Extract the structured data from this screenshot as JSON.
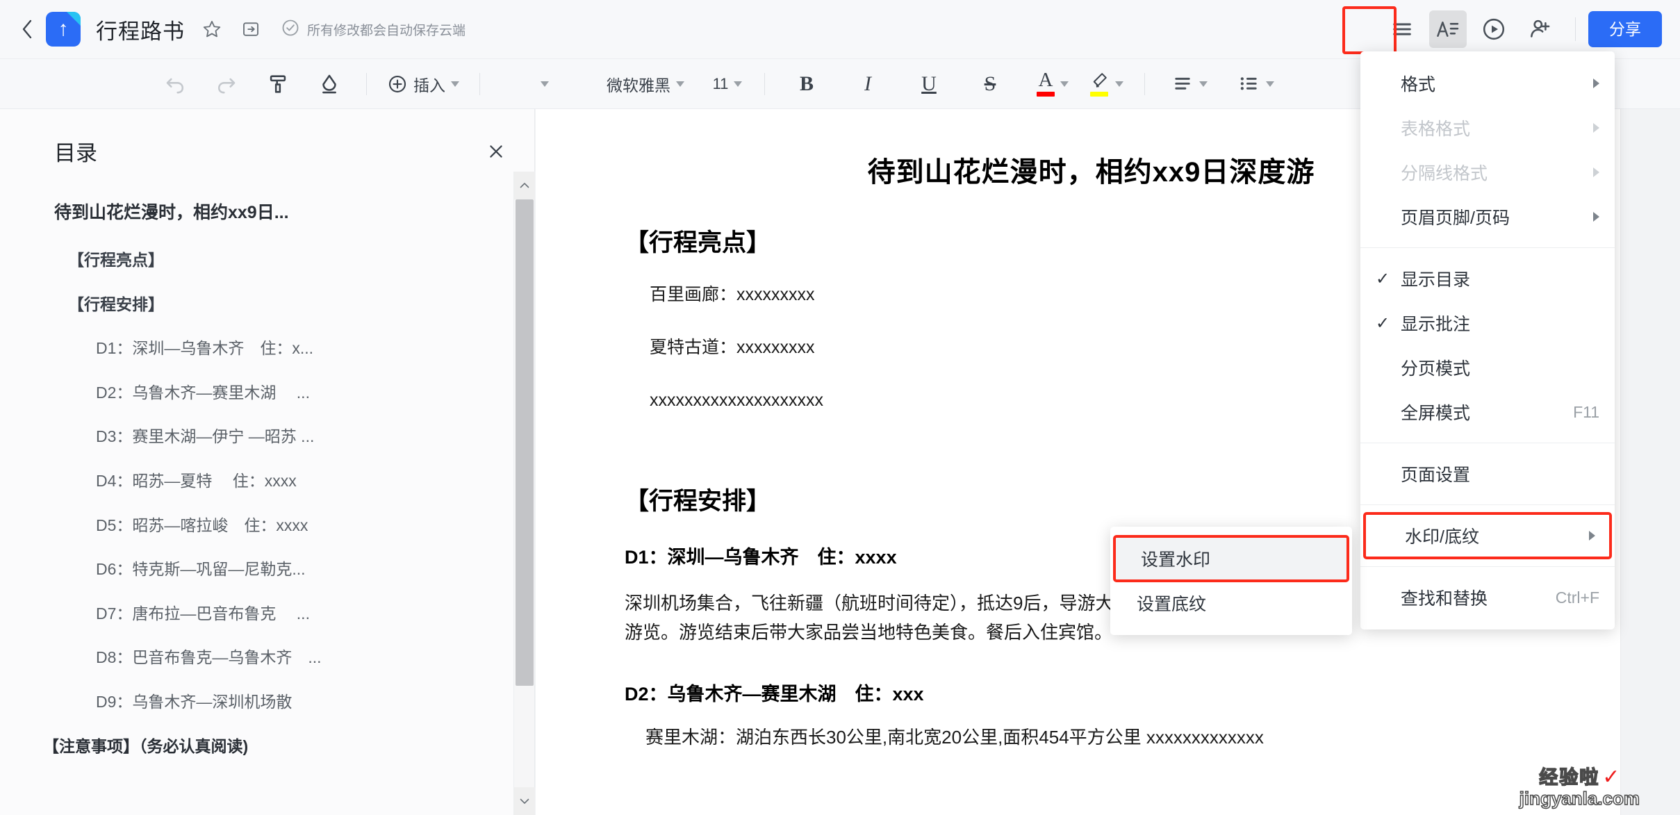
{
  "header": {
    "back_icon": "back-chevron-icon",
    "logo_icon": "app-logo-icon",
    "doc_title": "行程路书",
    "star_icon": "star-icon",
    "move_icon": "move-to-folder-icon",
    "save_check_icon": "check-circle-icon",
    "save_status": "所有修改都会自动保存云端",
    "menu_icon": "hamburger-menu-icon",
    "format_icon": "text-format-icon",
    "history_icon": "play-circle-icon",
    "invite_icon": "add-user-icon",
    "share_label": "分享",
    "accent_color": "#2b6cf6",
    "highlight_color": "#fc2b1b"
  },
  "toolbar": {
    "undo_icon": "undo-icon",
    "redo_icon": "redo-icon",
    "format_painter_icon": "format-painter-icon",
    "clear_format_icon": "clear-format-icon",
    "insert_label": "插入",
    "insert_icon": "plus-circle-icon",
    "style_label": "",
    "font_name": "微软雅黑",
    "font_size": "11",
    "bold_label": "B",
    "italic_label": "I",
    "underline_label": "U",
    "strike_label": "S",
    "font_color_label": "A",
    "font_color": "#ff0000",
    "highlight_icon": "highlighter-icon",
    "highlight_color": "#ffff00",
    "align_icon": "align-left-icon",
    "list_icon": "bullet-list-icon"
  },
  "sidebar": {
    "title": "目录",
    "close_icon": "close-icon",
    "scroll_up_icon": "chevron-up-icon",
    "scroll_down_icon": "chevron-down-icon",
    "items": [
      {
        "level": 1,
        "label": "待到山花烂漫时，相约xx9日..."
      },
      {
        "level": 2,
        "label": "【行程亮点】"
      },
      {
        "level": 2,
        "label": "【行程安排】"
      },
      {
        "level": 3,
        "label": "D1：深圳—乌鲁木齐　住：x..."
      },
      {
        "level": 3,
        "label": "D2：乌鲁木齐—赛里木湖　 ..."
      },
      {
        "level": 3,
        "label": "D3：赛里木湖—伊宁 —昭苏 ..."
      },
      {
        "level": 3,
        "label": "D4：昭苏—夏特　 住：xxxx"
      },
      {
        "level": 3,
        "label": "D5：昭苏—喀拉峻　住：xxxx"
      },
      {
        "level": 3,
        "label": "D6：特克斯—巩留—尼勒克..."
      },
      {
        "level": 3,
        "label": "D7：唐布拉—巴音布鲁克　 ..."
      },
      {
        "level": 3,
        "label": "D8：巴音布鲁克—乌鲁木齐　..."
      },
      {
        "level": 3,
        "label": "D9：乌鲁木齐—深圳机场散"
      },
      {
        "level": 0,
        "label": "【注意事项】（务必认真阅读)"
      }
    ]
  },
  "document": {
    "title": "待到山花烂漫时，相约xx9日深度游",
    "section1_heading": "【行程亮点】",
    "highlights": [
      "百里画廊：xxxxxxxxx",
      "夏特古道：xxxxxxxxx",
      "xxxxxxxxxxxxxxxxxxxx"
    ],
    "section2_heading": "【行程安排】",
    "d1_heading": "D1：深圳—乌鲁木齐　住：xxxx",
    "d1_body_line1": "深圳机场集合，飞往新疆（航班时间待定），抵达9后，导游大家前往酒店",
    "d1_body_line2": "游览。游览结束后带大家品尝当地特色美食。餐后入住宾馆。",
    "d2_heading": "D2：乌鲁木齐—赛里木湖　住：xxx",
    "d2_body": "赛里木湖：湖泊东西长30公里,南北宽20公里,面积454平方公里 xxxxxxxxxxxxx"
  },
  "menu": {
    "items": [
      {
        "label": "格式",
        "submenu": true,
        "disabled": false,
        "checked": false,
        "shortcut": ""
      },
      {
        "label": "表格格式",
        "submenu": true,
        "disabled": true,
        "checked": false,
        "shortcut": ""
      },
      {
        "label": "分隔线格式",
        "submenu": true,
        "disabled": true,
        "checked": false,
        "shortcut": ""
      },
      {
        "label": "页眉页脚/页码",
        "submenu": true,
        "disabled": false,
        "checked": false,
        "shortcut": ""
      },
      {
        "label": "显示目录",
        "submenu": false,
        "disabled": false,
        "checked": true,
        "shortcut": ""
      },
      {
        "label": "显示批注",
        "submenu": false,
        "disabled": false,
        "checked": true,
        "shortcut": ""
      },
      {
        "label": "分页模式",
        "submenu": false,
        "disabled": false,
        "checked": false,
        "shortcut": ""
      },
      {
        "label": "全屏模式",
        "submenu": false,
        "disabled": false,
        "checked": false,
        "shortcut": "F11"
      },
      {
        "label": "页面设置",
        "submenu": false,
        "disabled": false,
        "checked": false,
        "shortcut": ""
      },
      {
        "label": "水印/底纹",
        "submenu": true,
        "disabled": false,
        "checked": false,
        "shortcut": "",
        "highlighted": true
      },
      {
        "label": "查找和替换",
        "submenu": false,
        "disabled": false,
        "checked": false,
        "shortcut": "Ctrl+F"
      }
    ],
    "check_glyph": "✓"
  },
  "submenu": {
    "items": [
      {
        "label": "设置水印",
        "highlighted": true
      },
      {
        "label": "设置底纹",
        "highlighted": false
      }
    ]
  },
  "watermark": {
    "line1": "经验啦",
    "check": "✓",
    "line2": "jingyanla.com"
  }
}
